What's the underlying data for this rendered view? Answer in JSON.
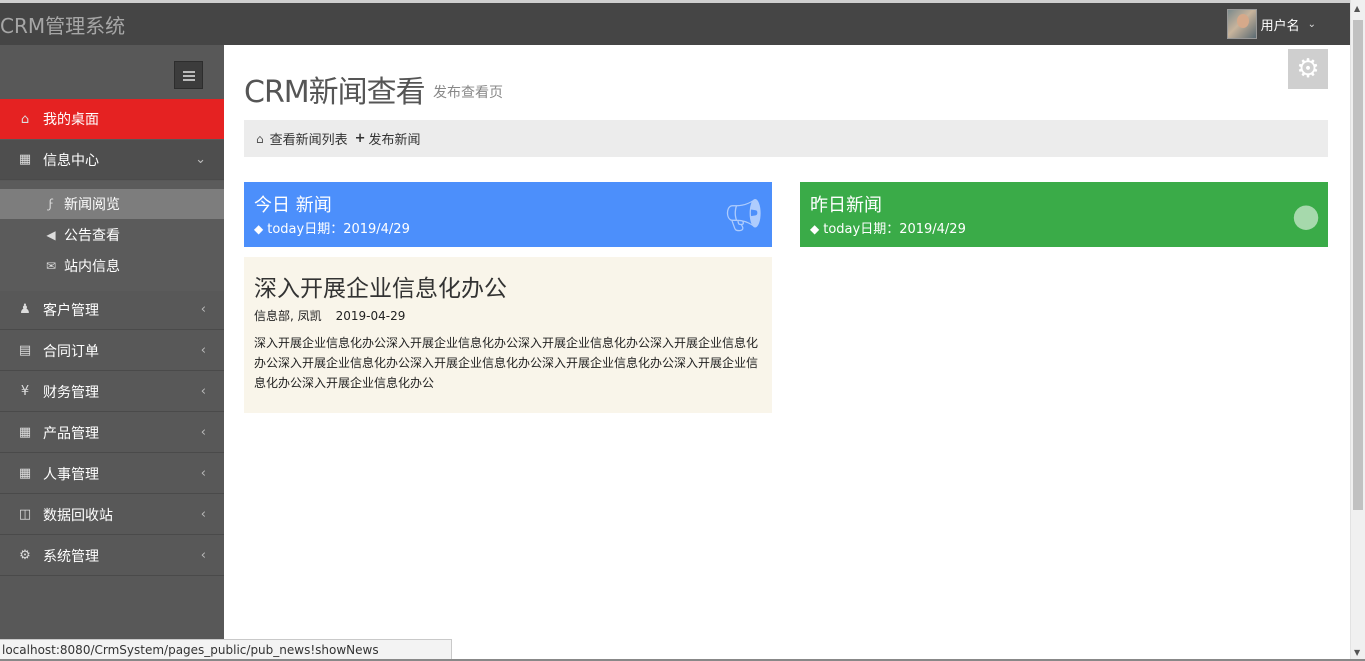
{
  "app": {
    "brand": "CRM管理系统"
  },
  "user": {
    "name": "用户名",
    "avatar_icon": "user-avatar",
    "caret_icon": "chevron-down-icon"
  },
  "sidebar": {
    "items": [
      {
        "label": "我的桌面",
        "icon": "home-icon",
        "state": "active"
      },
      {
        "label": "信息中心",
        "icon": "inbox-icon",
        "state": "open"
      },
      {
        "label": "客户管理",
        "icon": "person-icon"
      },
      {
        "label": "合同订单",
        "icon": "book-icon"
      },
      {
        "label": "财务管理",
        "icon": "yen-icon"
      },
      {
        "label": "产品管理",
        "icon": "table-icon"
      },
      {
        "label": "人事管理",
        "icon": "table-icon"
      },
      {
        "label": "数据回收站",
        "icon": "trash-icon"
      },
      {
        "label": "系统管理",
        "icon": "gear-icon"
      }
    ],
    "sub_items": [
      {
        "label": "新闻阅览",
        "icon": "bolt-icon",
        "selected": true
      },
      {
        "label": "公告查看",
        "icon": "volume-icon"
      },
      {
        "label": "站内信息",
        "icon": "envelope-icon"
      }
    ]
  },
  "main": {
    "title": "CRM新闻查看",
    "subtitle": "发布查看页",
    "breadcrumb": {
      "list_label": "查看新闻列表",
      "publish_label": "发布新闻"
    },
    "today": {
      "title": "今日 新闻",
      "date_label": "today日期：2019/4/29",
      "icon": "bullhorn-icon",
      "color": "#4c8ffb"
    },
    "yesterday": {
      "title": "昨日新闻",
      "date_label": "today日期：2019/4/29",
      "icon": "globe-icon",
      "color": "#3aab48"
    },
    "news": {
      "title": "深入开展企业信息化办公",
      "meta": "信息部, 凤凯",
      "date": "2019-04-29",
      "body": "深入开展企业信息化办公深入开展企业信息化办公深入开展企业信息化办公深入开展企业信息化办公深入开展企业信息化办公深入开展企业信息化办公深入开展企业信息化办公深入开展企业信息化办公深入开展企业信息化办公"
    }
  },
  "status_bar": {
    "url": "localhost:8080/CrmSystem/pages_public/pub_news!showNews"
  },
  "colors": {
    "topbar": "#454545",
    "sidebar": "#585858",
    "active": "#e52222"
  }
}
